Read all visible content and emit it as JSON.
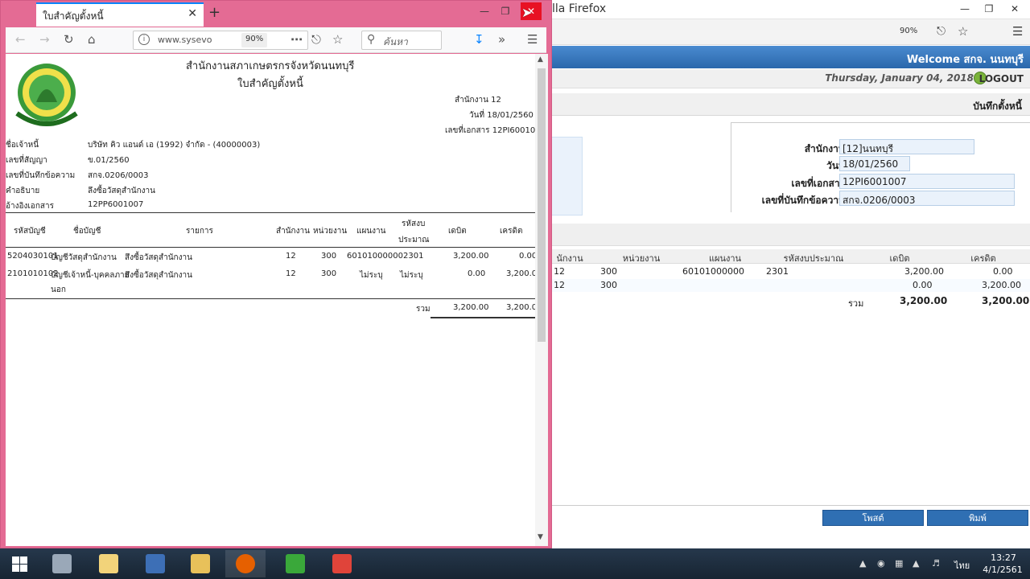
{
  "bg_window": {
    "title": "lla Firefox",
    "zoom": "90%",
    "welcome": "Welcome สกจ. นนทบุรี",
    "date": "Thursday, January 04, 2018",
    "logout": "LOGOUT",
    "section_title": "บันทึกตั้งหนี้",
    "form": [
      {
        "label": "สำนักงาน :",
        "value": "[12]นนทบุรี"
      },
      {
        "label": "วันที่ :",
        "value": "18/01/2560"
      },
      {
        "label": "เลขที่เอกสาร :",
        "value": "12PI6001007"
      },
      {
        "label": "เลขที่บันทึกข้อความ :",
        "value": "สกจ.0206/0003"
      }
    ],
    "grid_columns": [
      "นักงาน",
      "หน่วยงาน",
      "แผนงาน",
      "รหัสงบประมาณ",
      "เดบิต",
      "เครดิต"
    ],
    "grid_rows": [
      [
        "12",
        "300",
        "60101000000",
        "2301",
        "3,200.00",
        "0.00"
      ],
      [
        "12",
        "300",
        "",
        "",
        "0.00",
        "3,200.00"
      ]
    ],
    "total_label": "รวม",
    "total_debit": "3,200.00",
    "total_credit": "3,200.00",
    "buttons": {
      "post": "โพสต์",
      "print": "พิมพ์"
    }
  },
  "fg_window": {
    "tab_title": "ใบสำคัญตั้งหนี้",
    "url": "www.sysevo",
    "zoom": "90%",
    "search_placeholder": "ค้นหา",
    "doc": {
      "org": "สำนักงานสภาเกษตรกรจังหวัดนนทบุรี",
      "title": "ใบสำคัญตั้งหนี้",
      "office": "สำนักงาน 12",
      "date": "วันที่ 18/01/2560",
      "docno": "เลขที่เอกสาร 12PI6001007",
      "fields": [
        {
          "label": "ชื่อเจ้าหนี้",
          "value": "บริษัท คิว แอนด์ เอ (1992) จำกัด - (40000003)"
        },
        {
          "label": "เลขที่สัญญา",
          "value": "ข.01/2560"
        },
        {
          "label": "เลขที่บันทึกข้อความ",
          "value": "สกจ.0206/0003"
        },
        {
          "label": "คำอธิบาย",
          "value": "ลึงซื้อวัสดุสำนักงาน"
        },
        {
          "label": "อ้างอิงเอกสาร",
          "value": "12PP6001007"
        }
      ],
      "columns": [
        "รหัสบัญชี",
        "ชื่อบัญชี",
        "รายการ",
        "สำนักงาน",
        "หน่วยงาน",
        "แผนงาน",
        "รหัสงบ",
        "ประมาณ",
        "เดบิต",
        "เครดิต"
      ],
      "rows": [
        {
          "code": "5204030101",
          "name": "บัญชีวัสดุสำนักงาน",
          "name2": "",
          "item": "สึงซื้อวัสดุสำนักงาน",
          "office": "12",
          "unit": "300",
          "plan": "60101000000",
          "budget": "2301",
          "debit": "3,200.00",
          "credit": "0.00"
        },
        {
          "code": "2101010102",
          "name": "บัญชีเจ้าหนี้-บุคคลภาย",
          "name2": "นอก",
          "item": "สึงซื้อวัสดุสำนักงาน",
          "office": "12",
          "unit": "300",
          "plan": "ไม่ระบุ",
          "budget": "ไม่ระบุ",
          "debit": "0.00",
          "credit": "3,200.00"
        }
      ],
      "total_label": "รวม",
      "total_debit": "3,200.00",
      "total_credit": "3,200.00"
    }
  },
  "taskbar": {
    "time": "13:27",
    "date": "4/1/2561",
    "lang": "ไทย"
  }
}
